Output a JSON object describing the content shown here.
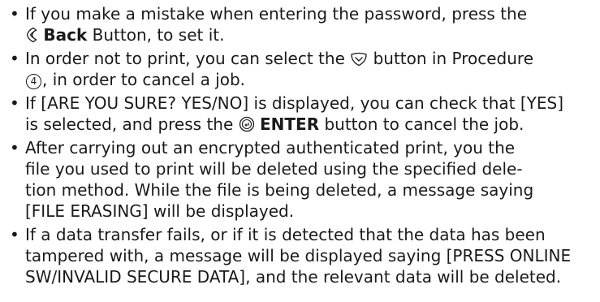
{
  "notes": [
    {
      "line1": "If you make a mistake when entering the password, press the",
      "back_label": "Back",
      "line2_end": "Button, to set it."
    },
    {
      "line1_a": "In order not to print, you can select the",
      "line1_b": "button in Procedure",
      "procedure_number": "4",
      "line2_end": ", in order to cancel a job."
    },
    {
      "line1": "If [ARE YOU SURE? YES/NO] is displayed, you can check that [YES]",
      "line2_a": "is selected, and press the",
      "enter_label": "ENTER",
      "line2_b": "button to cancel the job."
    },
    {
      "lines": [
        "After carrying out an encrypted authenticated print, you the",
        "file you used to print will be deleted using the specified dele-",
        "tion method. While the file is being deleted, a message saying",
        "[FILE ERASING] will be displayed."
      ]
    },
    {
      "lines": [
        "If a data transfer fails, or if it is detected that the data has been",
        "tampered with, a message will be displayed saying [PRESS ONLINE",
        "SW/INVALID SECURE DATA], and the relevant data will be deleted."
      ]
    }
  ],
  "icons": {
    "back": "back-button-icon",
    "cancel": "cancel-button-icon",
    "enter": "enter-button-icon"
  }
}
